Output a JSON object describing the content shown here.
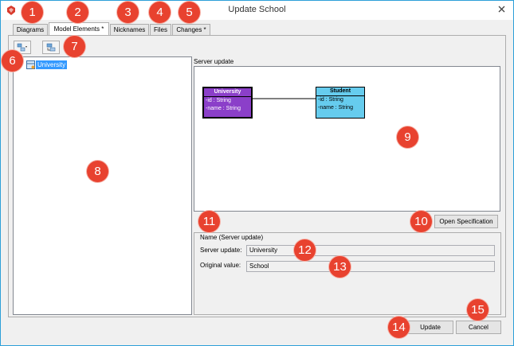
{
  "window": {
    "title": "Update School"
  },
  "tabs": [
    {
      "label": "Diagrams"
    },
    {
      "label": "Model Elements *"
    },
    {
      "label": "Nicknames"
    },
    {
      "label": "Files"
    },
    {
      "label": "Changes *"
    }
  ],
  "tree": {
    "items": [
      {
        "label": "University",
        "icon": "class-icon"
      }
    ]
  },
  "diagram": {
    "section_title": "Server update",
    "classes": [
      {
        "name": "University",
        "attributes": [
          "-id : String",
          "-name : String"
        ],
        "fill": "#8b3fc9",
        "header_text_color": "#ffffff"
      },
      {
        "name": "Student",
        "attributes": [
          "-id : String",
          "-name : String"
        ],
        "fill": "#66ccee",
        "header_text_color": "#000000"
      }
    ],
    "open_spec_label": "Open Specification"
  },
  "details": {
    "section_title": "Name (Server update)",
    "server_update_label": "Server update:",
    "server_update_value": "University",
    "original_value_label": "Original value:",
    "original_value_value": "School"
  },
  "footer": {
    "update_label": "Update",
    "cancel_label": "Cancel"
  },
  "callouts": [
    "1",
    "2",
    "3",
    "4",
    "5",
    "6",
    "7",
    "8",
    "9",
    "10",
    "11",
    "12",
    "13",
    "14",
    "15"
  ],
  "colors": {
    "callout": "#e8422f",
    "selection": "#3399ff",
    "window_border": "#2d9fd9"
  }
}
